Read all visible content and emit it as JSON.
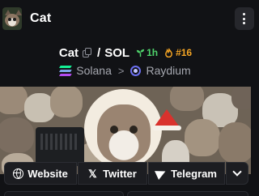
{
  "header": {
    "title": "Cat",
    "avatar_icon": "cat-avatar",
    "menu_icon": "kebab-menu-icon"
  },
  "pair": {
    "base": "Cat",
    "separator": "/",
    "quote": "SOL",
    "age": "1h",
    "age_icon": "seedling-icon",
    "age_color": "#4fd26b",
    "rank": "#16",
    "rank_icon": "flame-icon",
    "rank_color": "#f5a524"
  },
  "chain": {
    "network": "Solana",
    "separator": ">",
    "dex": "Raydium"
  },
  "links": {
    "website": "Website",
    "twitter": "Twitter",
    "telegram": "Telegram"
  },
  "colors": {
    "background": "#111215",
    "button_bg": "#1c1d21",
    "muted_text": "#a6a8b0"
  }
}
